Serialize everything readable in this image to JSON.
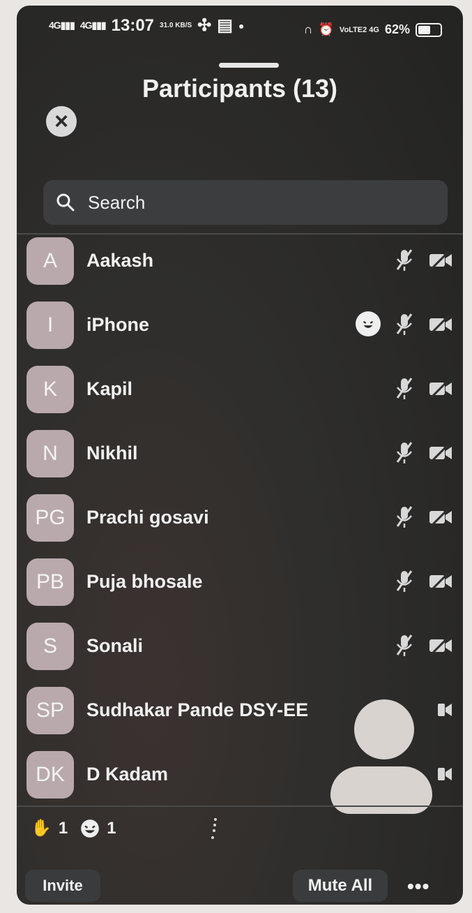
{
  "status_bar": {
    "signal_1": "4G",
    "signal_2": "4G",
    "time": "13:07",
    "network_speed": "31.0 KB/S",
    "battery_percent": "62%",
    "battery_level": 0.62,
    "volte": "VoLTE2 4G"
  },
  "header": {
    "title": "Participants (13)"
  },
  "search": {
    "placeholder": "Search"
  },
  "participants": [
    {
      "initials": "A",
      "name": "Aakash"
    },
    {
      "initials": "I",
      "name": "iPhone"
    },
    {
      "initials": "K",
      "name": "Kapil"
    },
    {
      "initials": "N",
      "name": "Nikhil"
    },
    {
      "initials": "PG",
      "name": "Prachi gosavi"
    },
    {
      "initials": "PB",
      "name": "Puja bhosale"
    },
    {
      "initials": "S",
      "name": "Sonali"
    },
    {
      "initials": "SP",
      "name": "Sudhakar Pande DSY-EE"
    },
    {
      "initials": "DK",
      "name": "D Kadam"
    }
  ],
  "reactions": {
    "raised_hands": "1",
    "emoji_count": "1"
  },
  "footer": {
    "invite_label": "Invite",
    "mute_all_label": "Mute All",
    "more_label": "•••"
  },
  "colors": {
    "avatar_bg": "#b9a9ad",
    "panel_bg": "#2f2e2c",
    "button_bg": "#3a3b3c"
  }
}
